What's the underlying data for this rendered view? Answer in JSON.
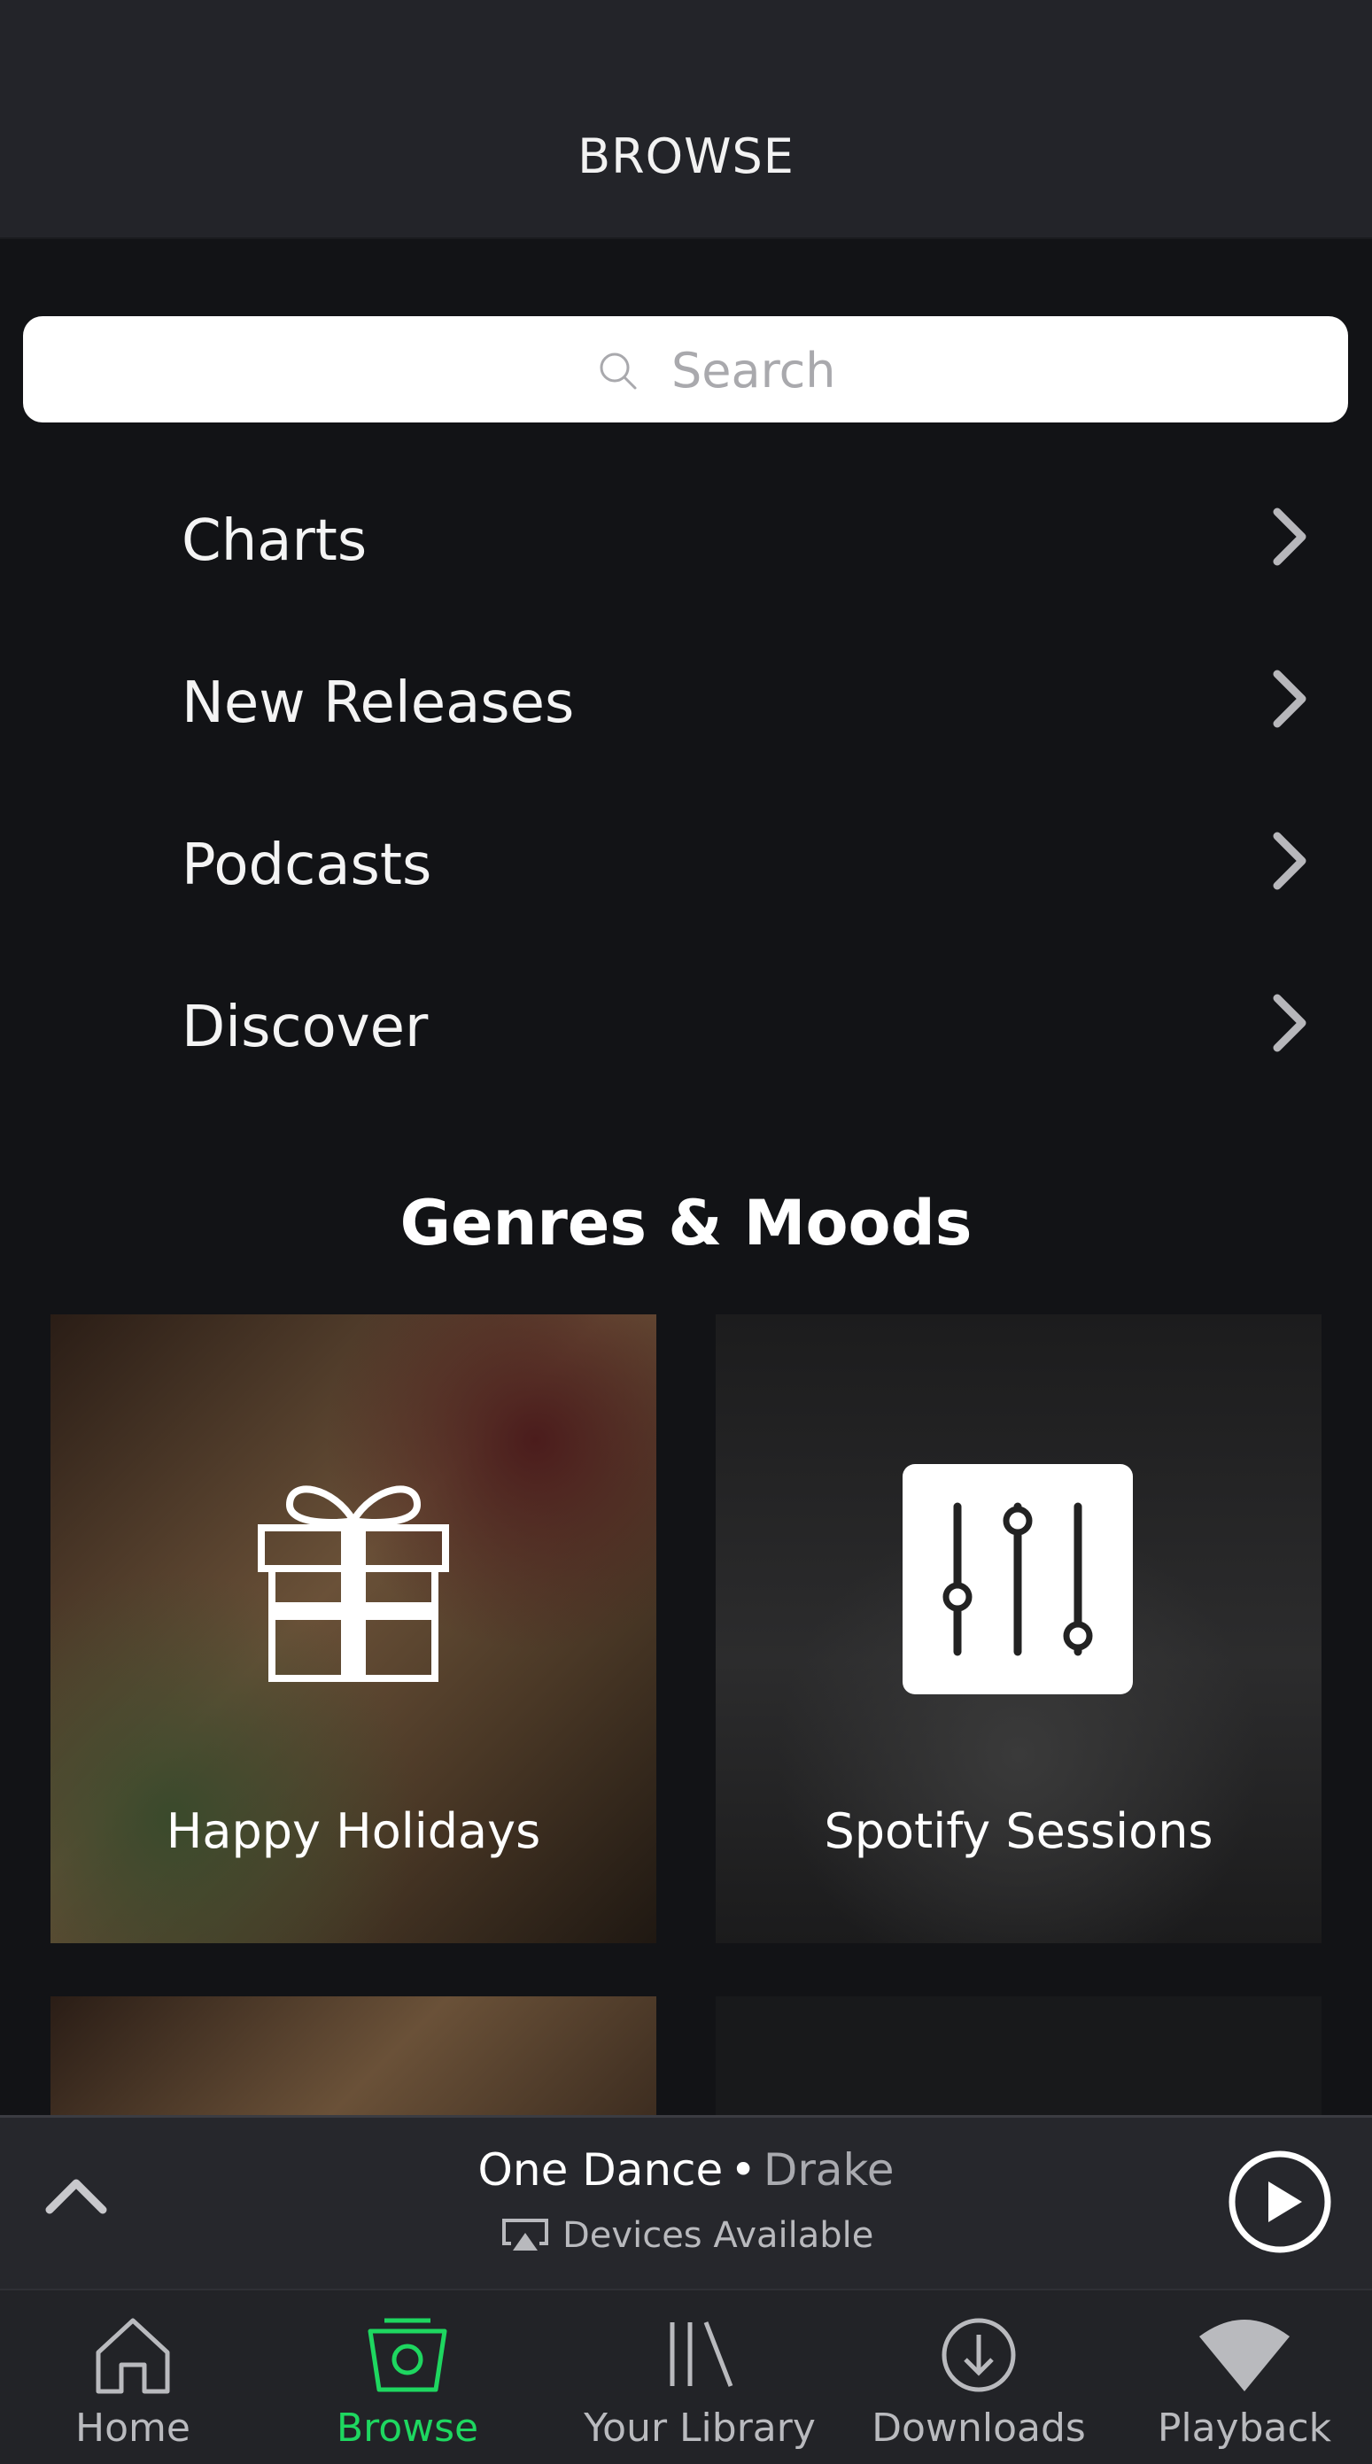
{
  "header": {
    "title": "BROWSE"
  },
  "search": {
    "placeholder": "Search"
  },
  "menu": [
    {
      "label": "Charts"
    },
    {
      "label": "New Releases"
    },
    {
      "label": "Podcasts"
    },
    {
      "label": "Discover"
    }
  ],
  "genres": {
    "title": "Genres & Moods",
    "tiles": [
      {
        "label": "Happy Holidays"
      },
      {
        "label": "Spotify Sessions"
      }
    ]
  },
  "player": {
    "track": "One Dance",
    "separator": "•",
    "artist": "Drake",
    "devices": "Devices Available"
  },
  "tabs": [
    {
      "label": "Home",
      "icon": "home-icon",
      "active": false
    },
    {
      "label": "Browse",
      "icon": "browse-icon",
      "active": true
    },
    {
      "label": "Your Library",
      "icon": "library-icon",
      "active": false
    },
    {
      "label": "Downloads",
      "icon": "downloads-icon",
      "active": false
    },
    {
      "label": "Playback",
      "icon": "playback-icon",
      "active": false
    }
  ],
  "colors": {
    "accent": "#1ed760",
    "background": "#121316",
    "header": "#232429",
    "player": "#26272c",
    "tabbar": "#222327"
  }
}
